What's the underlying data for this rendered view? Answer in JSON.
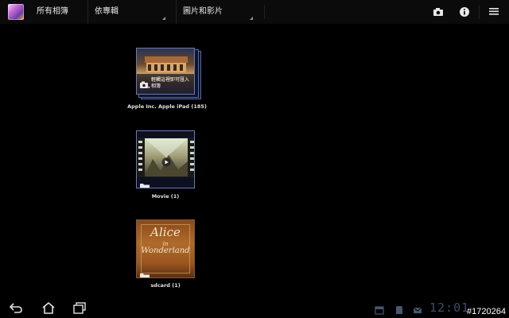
{
  "actionbar": {
    "tabs": [
      {
        "label": "所有相簿"
      },
      {
        "label": "依專輯"
      },
      {
        "label": "圖片和影片"
      }
    ],
    "icons": [
      "camera-icon",
      "info-icon",
      "menu-icon"
    ]
  },
  "albums": [
    {
      "label": "Apple Inc. Apple iPad (185)",
      "overlay_text": "輕觸這裡即可匯入相簿"
    },
    {
      "label": "Movie (1)"
    },
    {
      "label": "sdcard (1)",
      "cover_text": [
        "Alice",
        "in",
        "Wonderland"
      ]
    }
  ],
  "statusbar": {
    "clock": "12:01",
    "watermark": "#1720264"
  },
  "colors": {
    "background": "#000000",
    "thumbnail_border": "#6a7ab0"
  }
}
